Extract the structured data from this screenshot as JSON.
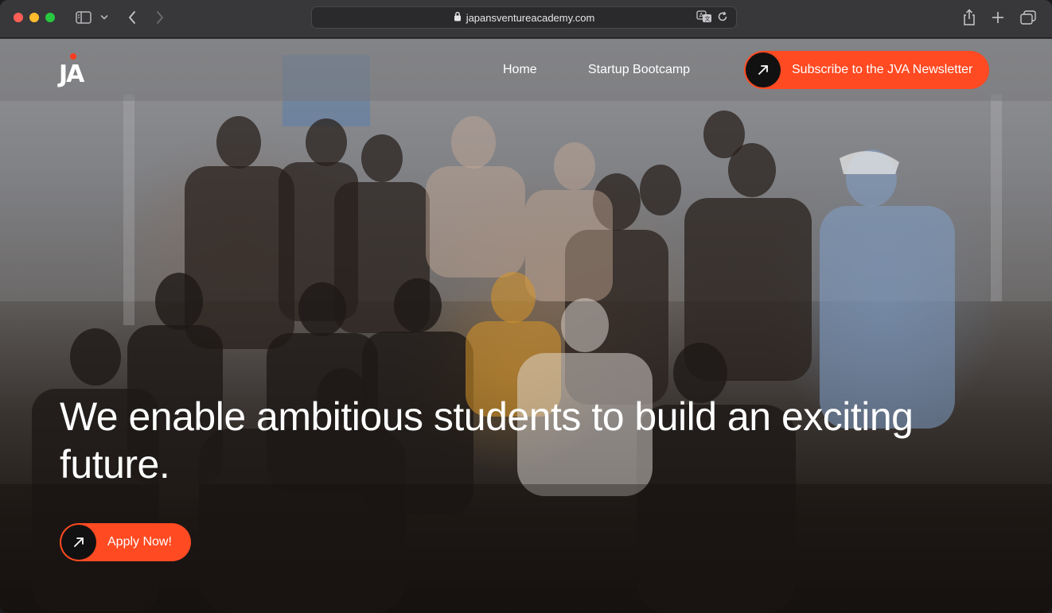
{
  "browser": {
    "url": "japansventureacademy.com",
    "icons": {
      "sidebar": "sidebar-icon",
      "chevron": "chevron-down-icon",
      "back": "back-arrow-icon",
      "forward": "forward-arrow-icon",
      "lock": "lock-icon",
      "translate": "translate-icon",
      "reload": "reload-icon",
      "share": "share-icon",
      "new_tab": "plus-icon",
      "tabs": "tab-overview-icon"
    }
  },
  "site": {
    "logo": "JA",
    "nav": {
      "home": "Home",
      "bootcamp": "Startup Bootcamp",
      "newsletter_cta": "Subscribe to the JVA Newsletter"
    },
    "hero": {
      "headline": "We enable ambitious students to build an exciting future.",
      "cta": "Apply Now!"
    }
  },
  "colors": {
    "accent": "#ff4a22",
    "logo_dot": "#ff3b1f",
    "cta_circle": "#111111"
  }
}
